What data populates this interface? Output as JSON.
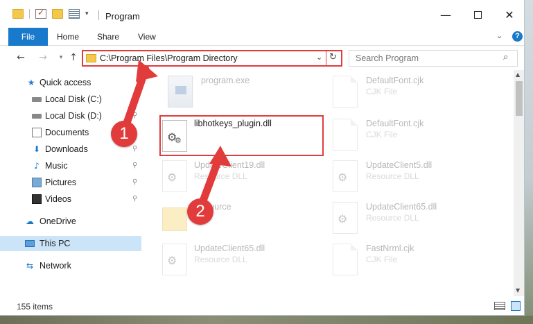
{
  "window": {
    "title": "Program",
    "controls": {
      "minimize": "—",
      "close": "✕"
    }
  },
  "ribbon": {
    "tabs": [
      "File",
      "Home",
      "Share",
      "View"
    ],
    "chevron": "⌄",
    "help": "?"
  },
  "navigation": {
    "back": "←",
    "forward": "→",
    "recent": "▾",
    "up": "↑",
    "address": "C:\\Program Files\\Program Directory",
    "address_dropdown": "⌄",
    "refresh": "↻",
    "search_placeholder": "Search Program",
    "search_icon": "⌕"
  },
  "sidebar": {
    "items": [
      {
        "label": "Quick access",
        "icon": "★",
        "pinned": false,
        "selected": false
      },
      {
        "label": "Local Disk (C:)",
        "icon": "",
        "pinned": true,
        "selected": false
      },
      {
        "label": "Local Disk (D:)",
        "icon": "",
        "pinned": true,
        "selected": false
      },
      {
        "label": "Documents",
        "icon": "",
        "pinned": true,
        "selected": false
      },
      {
        "label": "Downloads",
        "icon": "⬇",
        "pinned": true,
        "selected": false
      },
      {
        "label": "Music",
        "icon": "♪",
        "pinned": true,
        "selected": false
      },
      {
        "label": "Pictures",
        "icon": "",
        "pinned": true,
        "selected": false
      },
      {
        "label": "Videos",
        "icon": "",
        "pinned": true,
        "selected": false
      },
      {
        "label": "OneDrive",
        "icon": "☁",
        "pinned": false,
        "selected": false
      },
      {
        "label": "This PC",
        "icon": "",
        "pinned": false,
        "selected": true
      },
      {
        "label": "Network",
        "icon": "⇆",
        "pinned": false,
        "selected": false
      }
    ],
    "pin_glyph": "⚲"
  },
  "files": [
    {
      "name": "program.exe",
      "type": "",
      "icon": "exe-icon",
      "faded": true
    },
    {
      "name": "DefaultFont.cjk",
      "type": "CJK File",
      "icon": "document-icon",
      "faded": true
    },
    {
      "name": "libhotkeys_plugin.dll",
      "type": "",
      "icon": "gear-file-icon",
      "faded": false,
      "highlighted": true
    },
    {
      "name": "DefaultFont.cjk",
      "type": "CJK File",
      "icon": "document-icon",
      "faded": true
    },
    {
      "name": "UpdateClient19.dll",
      "type": "Resource DLL",
      "icon": "gear-file-icon",
      "faded": true
    },
    {
      "name": "UpdateClient5.dll",
      "type": "Resource DLL",
      "icon": "gear-file-icon",
      "faded": true
    },
    {
      "name": "Resource",
      "type": "",
      "icon": "folder-icon",
      "faded": true
    },
    {
      "name": "UpdateClient65.dll",
      "type": "Resource DLL",
      "icon": "gear-file-icon",
      "faded": true
    },
    {
      "name": "UpdateClient65.dll",
      "type": "Resource DLL",
      "icon": "gear-file-icon",
      "faded": true
    },
    {
      "name": "FastNrml.cjk",
      "type": "CJK File",
      "icon": "document-icon",
      "faded": true
    }
  ],
  "statusbar": {
    "item_count": "155 items"
  },
  "annotations": {
    "step1": "1",
    "step2": "2",
    "color": "#e23b3b"
  },
  "colors": {
    "accent": "#1979ca",
    "selection": "#cce4f7",
    "highlight": "#e23b3b"
  }
}
